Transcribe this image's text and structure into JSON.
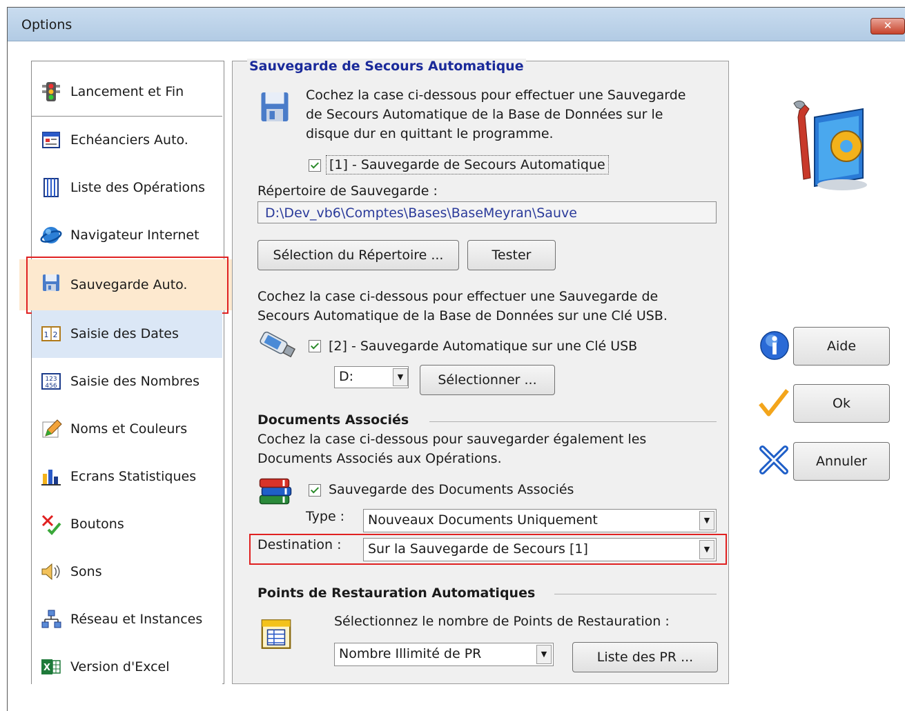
{
  "window": {
    "title": "Options",
    "close_label": "✕"
  },
  "sidebar": {
    "items": [
      {
        "label": "Lancement et Fin",
        "icon": "traffic-light-icon"
      },
      {
        "label": "Echéanciers Auto.",
        "icon": "calendar-icon"
      },
      {
        "label": "Liste des Opérations",
        "icon": "list-icon"
      },
      {
        "label": "Navigateur Internet",
        "icon": "globe-icon"
      },
      {
        "label": "Sauvegarde Auto.",
        "icon": "floppy-disk-icon",
        "active": true
      },
      {
        "label": "Saisie des Dates",
        "icon": "date-icon"
      },
      {
        "label": "Saisie des Nombres",
        "icon": "numbers-icon"
      },
      {
        "label": "Noms et Couleurs",
        "icon": "pencil-icon"
      },
      {
        "label": "Ecrans Statistiques",
        "icon": "bar-chart-icon"
      },
      {
        "label": "Boutons",
        "icon": "buttons-icon"
      },
      {
        "label": "Sons",
        "icon": "speaker-icon"
      },
      {
        "label": "Réseau et Instances",
        "icon": "network-icon"
      },
      {
        "label": "Version d'Excel",
        "icon": "excel-icon"
      }
    ]
  },
  "backup": {
    "group_title": "Sauvegarde de Secours Automatique",
    "desc_line1": "Cochez la case ci-dessous pour effectuer une Sauvegarde",
    "desc_line2": "de Secours Automatique de la Base de Données sur le",
    "desc_line3": "disque dur en quittant le programme.",
    "checkbox1_label": "[1] - Sauvegarde de Secours Automatique",
    "dir_label": "Répertoire de Sauvegarde :",
    "dir_value": "D:\\Dev_vb6\\Comptes\\Bases\\BaseMeyran\\Sauve",
    "select_dir_button": "Sélection du Répertoire ...",
    "test_button": "Tester",
    "usb_desc_line1": "Cochez la case ci-dessous pour effectuer une Sauvegarde de",
    "usb_desc_line2": "Secours Automatique de la Base de Données sur une Clé USB.",
    "checkbox2_label": "[2] - Sauvegarde Automatique sur une Clé USB",
    "drive_value": "D:",
    "select_button": "Sélectionner ..."
  },
  "documents": {
    "section_title": "Documents Associés",
    "desc_line1": "Cochez la case ci-dessous pour sauvegarder également les",
    "desc_line2": "Documents Associés aux Opérations.",
    "checkbox_label": "Sauvegarde des Documents Associés",
    "type_label": "Type :",
    "type_value": "Nouveaux Documents Uniquement",
    "destination_label": "Destination :",
    "destination_value": "Sur la Sauvegarde de Secours [1]"
  },
  "restore": {
    "section_title": "Points de Restauration Automatiques",
    "desc": "Sélectionnez le nombre de Points de Restauration :",
    "count_value": "Nombre Illimité de PR",
    "list_button": "Liste des PR ..."
  },
  "actions": {
    "help": "Aide",
    "ok": "Ok",
    "cancel": "Annuler"
  }
}
